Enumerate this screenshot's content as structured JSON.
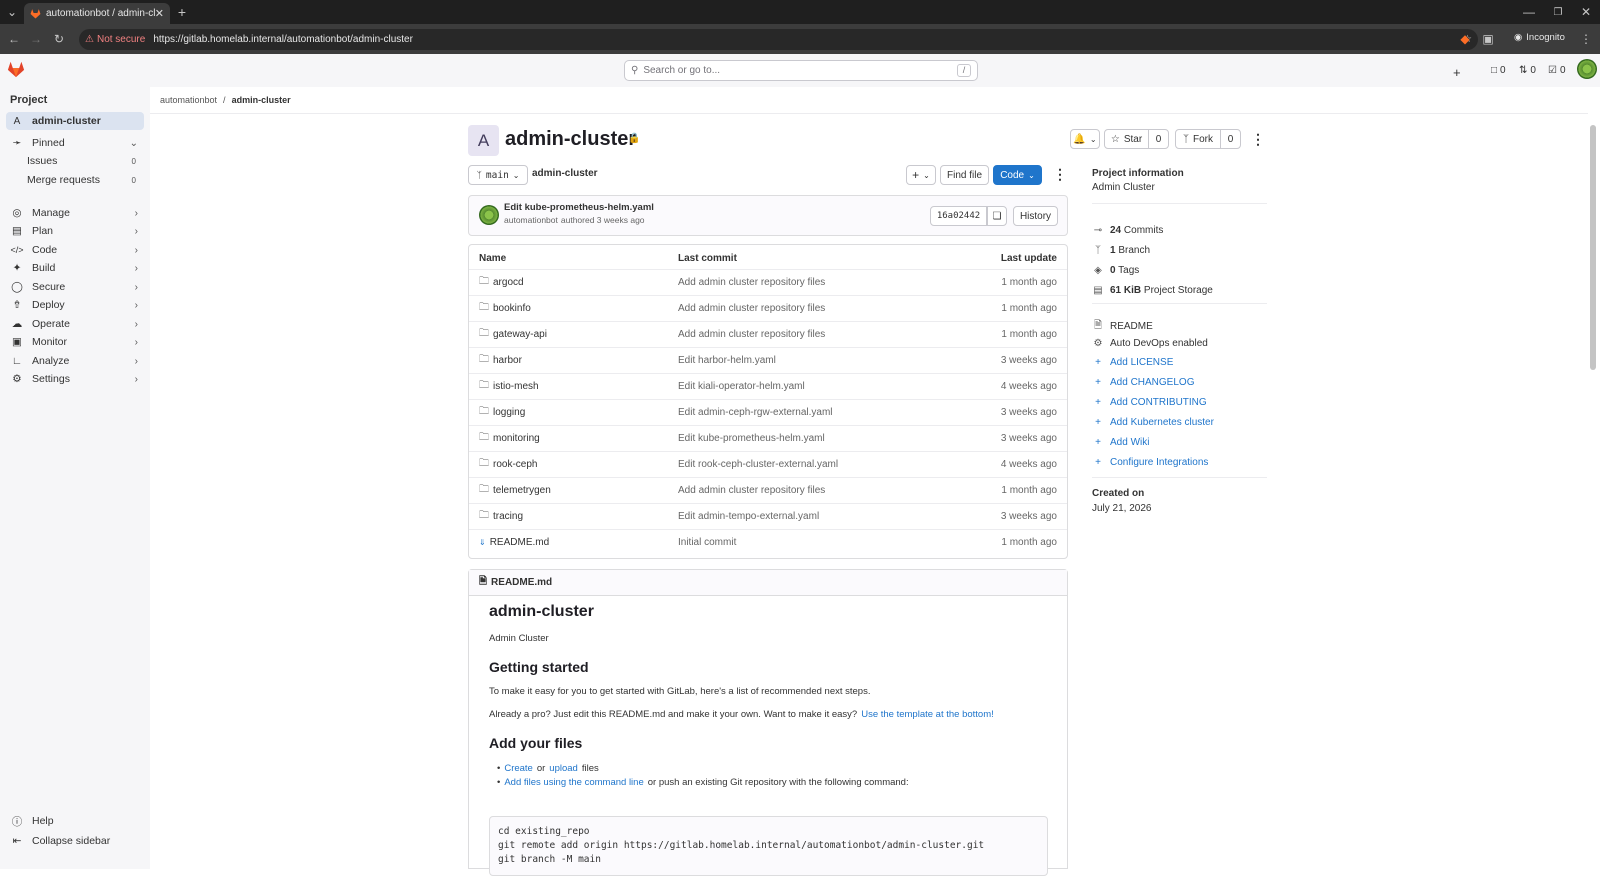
{
  "browser": {
    "tab_title": "automationbot / admin-cluster",
    "not_secure": "Not secure",
    "url_host": "https://gitlab.homelab.internal",
    "url_path": "/automationbot/admin-cluster",
    "incognito": "Incognito"
  },
  "top": {
    "search_placeholder": "Search or go to...",
    "search_key": "/",
    "issues_count": "0",
    "mr_count": "0",
    "todo_count": "0"
  },
  "sidebar": {
    "heading": "Project",
    "project_initial": "A",
    "project_name": "admin-cluster",
    "pinned": "Pinned",
    "pinned_items": [
      {
        "label": "Issues",
        "count": "0"
      },
      {
        "label": "Merge requests",
        "count": "0"
      }
    ],
    "nav": [
      "Manage",
      "Plan",
      "Code",
      "Build",
      "Secure",
      "Deploy",
      "Operate",
      "Monitor",
      "Analyze",
      "Settings"
    ],
    "help": "Help",
    "collapse": "Collapse sidebar"
  },
  "breadcrumb": {
    "owner": "automationbot",
    "project": "admin-cluster"
  },
  "project": {
    "avatar_letter": "A",
    "title": "admin-cluster",
    "star_label": "Star",
    "star_count": "0",
    "fork_label": "Fork",
    "fork_count": "0",
    "branch": "main",
    "path": "admin-cluster",
    "find_file": "Find file",
    "code_btn": "Code"
  },
  "last_commit": {
    "message": "Edit kube-prometheus-helm.yaml",
    "author": "automationbot",
    "meta": "authored 3 weeks ago",
    "sha": "16a02442",
    "history": "History"
  },
  "table": {
    "headers": {
      "name": "Name",
      "commit": "Last commit",
      "update": "Last update"
    },
    "rows": [
      {
        "name": "argocd",
        "type": "folder",
        "commit": "Add admin cluster repository files",
        "update": "1 month ago"
      },
      {
        "name": "bookinfo",
        "type": "folder",
        "commit": "Add admin cluster repository files",
        "update": "1 month ago"
      },
      {
        "name": "gateway-api",
        "type": "folder",
        "commit": "Add admin cluster repository files",
        "update": "1 month ago"
      },
      {
        "name": "harbor",
        "type": "folder",
        "commit": "Edit harbor-helm.yaml",
        "update": "3 weeks ago"
      },
      {
        "name": "istio-mesh",
        "type": "folder",
        "commit": "Edit kiali-operator-helm.yaml",
        "update": "4 weeks ago"
      },
      {
        "name": "logging",
        "type": "folder",
        "commit": "Edit admin-ceph-rgw-external.yaml",
        "update": "3 weeks ago"
      },
      {
        "name": "monitoring",
        "type": "folder",
        "commit": "Edit kube-prometheus-helm.yaml",
        "update": "3 weeks ago"
      },
      {
        "name": "rook-ceph",
        "type": "folder",
        "commit": "Edit rook-ceph-cluster-external.yaml",
        "update": "4 weeks ago"
      },
      {
        "name": "telemetrygen",
        "type": "folder",
        "commit": "Add admin cluster repository files",
        "update": "1 month ago"
      },
      {
        "name": "tracing",
        "type": "folder",
        "commit": "Edit admin-tempo-external.yaml",
        "update": "3 weeks ago"
      },
      {
        "name": "README.md",
        "type": "markdown",
        "commit": "Initial commit",
        "update": "1 month ago"
      }
    ]
  },
  "readme": {
    "file": "README.md",
    "h1": "admin-cluster",
    "desc": "Admin Cluster",
    "h2_start": "Getting started",
    "p1": "To make it easy for you to get started with GitLab, here's a list of recommended next steps.",
    "p2_text": "Already a pro? Just edit this README.md and make it your own. Want to make it easy?",
    "p2_link": "Use the template at the bottom!",
    "h2_files": "Add your files",
    "li1_create": "Create",
    "li1_or": "or",
    "li1_upload": "upload",
    "li1_files": "files",
    "li2_link": "Add files using the command line",
    "li2_text": "or push an existing Git repository with the following command:",
    "code_lines": [
      "cd existing_repo",
      "git remote add origin https://gitlab.homelab.internal/automationbot/admin-cluster.git",
      "git branch -M main"
    ]
  },
  "info": {
    "heading": "Project information",
    "desc": "Admin Cluster",
    "commits_n": "24",
    "commits": "Commits",
    "branch_n": "1",
    "branch": "Branch",
    "tags_n": "0",
    "tags": "Tags",
    "storage_n": "61 KiB",
    "storage": "Project Storage",
    "readme": "README",
    "autodevops": "Auto DevOps enabled",
    "adds": [
      "Add LICENSE",
      "Add CHANGELOG",
      "Add CONTRIBUTING",
      "Add Kubernetes cluster",
      "Add Wiki",
      "Configure Integrations"
    ],
    "created_label": "Created on",
    "created_date": "July 21, 2026"
  }
}
